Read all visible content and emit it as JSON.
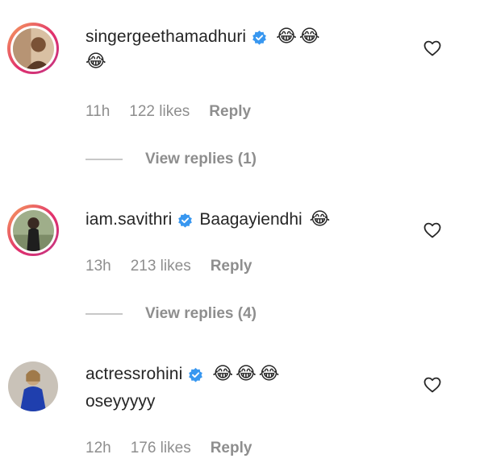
{
  "comments": [
    {
      "username": "singergeethamadhuri",
      "text": "",
      "emojis_line1": [
        "😂",
        "😂"
      ],
      "emojis_line2": [
        "😂"
      ],
      "time": "11h",
      "likes": "122 likes",
      "reply": "Reply",
      "view_replies": "View replies (1)"
    },
    {
      "username": "iam.savithri",
      "text": "Baagayiendhi",
      "emojis_line1": [
        "😂"
      ],
      "time": "13h",
      "likes": "213 likes",
      "reply": "Reply",
      "view_replies": "View replies (4)"
    },
    {
      "username": "actressrohini",
      "text": "",
      "emojis_line1": [
        "😂",
        "😂",
        "😂"
      ],
      "second_line": "oseyyyyy",
      "time": "12h",
      "likes": "176 likes",
      "reply": "Reply"
    }
  ],
  "colors": {
    "text": "#262626",
    "secondary": "#8e8e8e",
    "verified": "#3897f0",
    "story_ring": "#e1306c"
  },
  "icons": {
    "verified": "verified-badge-icon",
    "like": "heart-icon"
  }
}
